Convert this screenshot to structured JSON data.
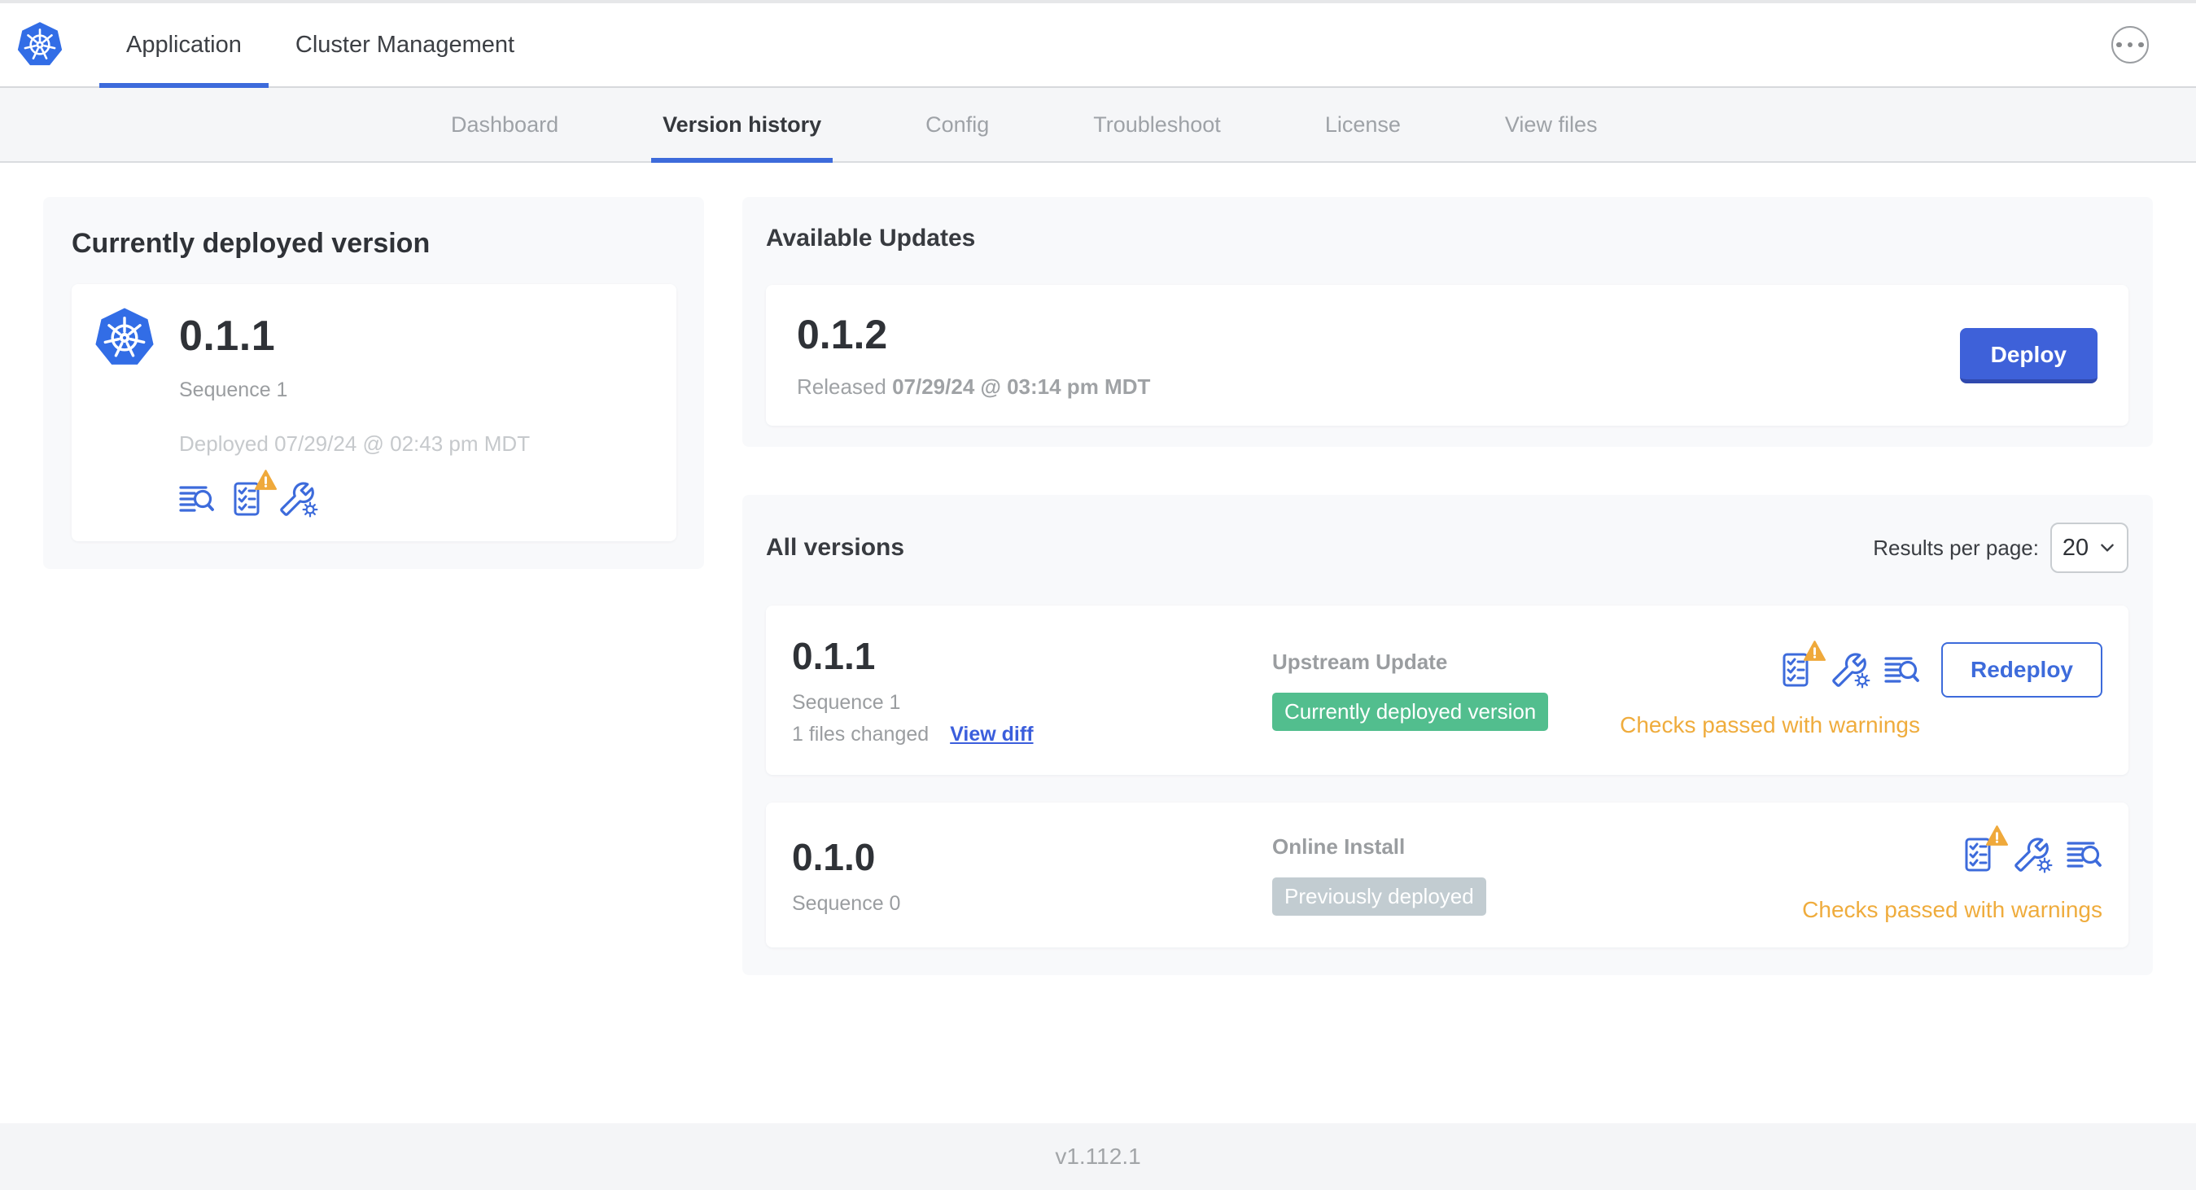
{
  "header": {
    "product_tabs": [
      {
        "label": "Application"
      },
      {
        "label": "Cluster Management"
      }
    ]
  },
  "subnav": {
    "tabs": [
      "Dashboard",
      "Version history",
      "Config",
      "Troubleshoot",
      "License",
      "View files"
    ]
  },
  "deployed": {
    "title": "Currently deployed version",
    "version": "0.1.1",
    "sequence": "Sequence 1",
    "deployed_at": "Deployed 07/29/24 @ 02:43 pm MDT"
  },
  "available": {
    "title": "Available Updates",
    "version": "0.1.2",
    "released_label": "Released ",
    "released_date": "07/29/24 @ 03:14 pm MDT",
    "deploy_label": "Deploy"
  },
  "all_versions": {
    "title": "All versions",
    "results_per_page_label": "Results per page:",
    "results_per_page": "20",
    "rows": [
      {
        "version": "0.1.1",
        "sequence": "Sequence 1",
        "files_changed": "1 files changed",
        "view_diff": "View diff",
        "source": "Upstream Update",
        "badge": "Currently deployed version",
        "status": "Checks passed with warnings",
        "action": "Redeploy"
      },
      {
        "version": "0.1.0",
        "sequence": "Sequence 0",
        "source": "Online Install",
        "badge": "Previously deployed",
        "status": "Checks passed with warnings"
      }
    ]
  },
  "footer": {
    "app_version": "v1.112.1"
  },
  "colors": {
    "accent_blue": "#3D6BDB",
    "kubernetes_blue": "#326DE6",
    "success_green": "#52BE8E",
    "muted_badge_gray": "#C2CCD1",
    "warning_orange": "#EFAC3D",
    "deploy_button_blue": "#3E61D9"
  },
  "icon_names": [
    "kubernetes-logo",
    "ellipsis-icon",
    "logs-icon",
    "preflight-checks-icon",
    "warning-icon",
    "config-icon",
    "chevron-down-icon"
  ]
}
